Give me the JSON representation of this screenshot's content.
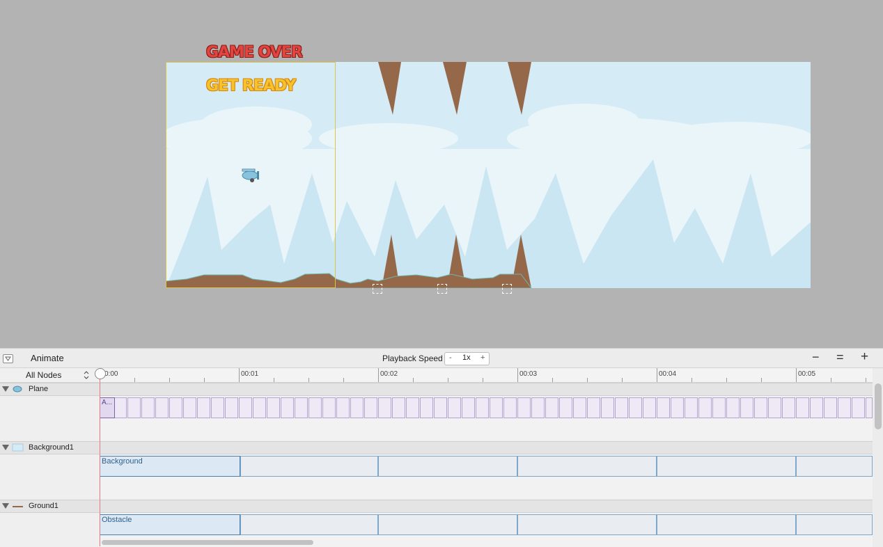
{
  "window": {
    "title": "Animate"
  },
  "scene": {
    "game_over_text": "GAME OVER",
    "get_ready_text": "GET READY",
    "colors": {
      "sky": "#d5ebf5",
      "cloud": "#eaf5fa",
      "mountain": "#c9e6f2",
      "ground": "#96684a",
      "selection": "#d9c64a"
    }
  },
  "toolbar": {
    "playback_label": "Playback Speed",
    "speed_minus": "-",
    "speed_value": "1x",
    "speed_plus": "+",
    "zoom_out": "−",
    "zoom_fit": "=",
    "zoom_in": "+"
  },
  "timeline": {
    "filter_label": "All Nodes",
    "ticks": [
      "0:00",
      "00:01",
      "00:02",
      "00:03",
      "00:04",
      "00:05"
    ],
    "nodes": [
      {
        "name": "Plane",
        "clip_label": "A..."
      },
      {
        "name": "Background1",
        "clip_label": "Background"
      },
      {
        "name": "Ground1",
        "clip_label": "Obstacle"
      }
    ]
  },
  "icons": {
    "collapse": "panel-collapse-icon",
    "disclosure": "disclosure-triangle-icon",
    "stepper": "updown-chevron-icon"
  }
}
